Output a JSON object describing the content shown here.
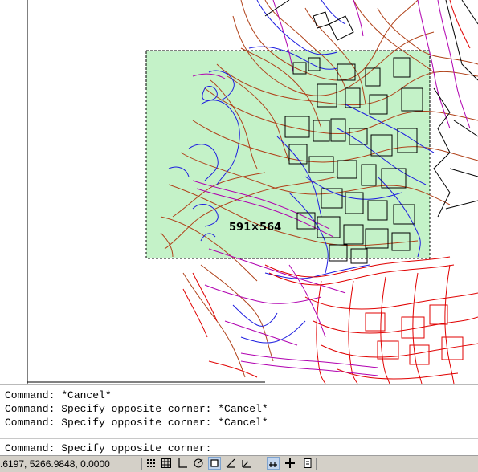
{
  "drawing": {
    "selection_size_label": "591×564",
    "selection_fill": "#c4f2c8",
    "colors": {
      "contour_brown": "#b0421a",
      "water_blue": "#1e1ee0",
      "building_black": "#000000",
      "road_magenta": "#b000b0",
      "road_red": "#e00000"
    }
  },
  "command_window": {
    "lines": [
      "Command: *Cancel*",
      "Command: Specify opposite corner: *Cancel*",
      "Command: Specify opposite corner: *Cancel*"
    ],
    "prompt": "Command: Specify opposite corner:"
  },
  "status_bar": {
    "coordinates": ".6197, 5266.9848, 0.0000",
    "toggles": [
      {
        "name": "snap-toggle",
        "icon": "snap-icon",
        "active": false
      },
      {
        "name": "grid-toggle",
        "icon": "grid-icon",
        "active": false
      },
      {
        "name": "ortho-toggle",
        "icon": "ortho-icon",
        "active": false
      },
      {
        "name": "polar-toggle",
        "icon": "polar-icon",
        "active": false
      },
      {
        "name": "osnap-toggle",
        "icon": "osnap-icon",
        "active": true
      },
      {
        "name": "otrack-toggle",
        "icon": "otrack-icon",
        "active": false
      },
      {
        "name": "ducs-toggle",
        "icon": "ducs-icon",
        "active": false
      },
      {
        "name": "dyn-toggle",
        "icon": "dyn-icon",
        "active": true
      },
      {
        "name": "lweight-toggle",
        "icon": "lineweight-icon",
        "active": false
      },
      {
        "name": "qp-toggle",
        "icon": "quick-properties-icon",
        "active": false
      }
    ]
  }
}
